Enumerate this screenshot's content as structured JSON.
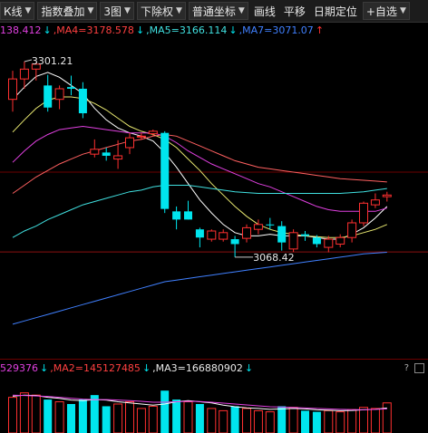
{
  "toolbar": {
    "items": [
      {
        "label": "К线",
        "dropdown": true
      },
      {
        "label": "指数叠加",
        "dropdown": true
      },
      {
        "label": "3图",
        "dropdown": true
      },
      {
        "label": "下除权",
        "dropdown": true
      },
      {
        "label": "普通坐标",
        "dropdown": true
      },
      {
        "label": "画线",
        "dropdown": false
      },
      {
        "label": "平移",
        "dropdown": false
      },
      {
        "label": "日期定位",
        "dropdown": false
      },
      {
        "label": "+自选",
        "dropdown": true
      }
    ]
  },
  "price_info": {
    "ma3": "138.412",
    "ma4": ",MA4=3178.578",
    "ma5": ",MA5=3166.114",
    "ma7": ",MA7=3071.07",
    "colors": {
      "ma3": "#e040e0",
      "ma4": "#ff4040",
      "ma5": "#40e0e0",
      "ma7": "#4080ff"
    }
  },
  "volume_info": {
    "ma1": "529376",
    "ma2": ",MA2=145127485",
    "ma3": ",MA3=166880902",
    "colors": {
      "ma1": "#e040e0",
      "ma2": "#ff4040",
      "ma3": "#e8e8e8"
    }
  },
  "chart_data": {
    "type": "candlestick",
    "ylim": [
      2940,
      3330
    ],
    "high_label": "3301.21",
    "low_label": "3068.42",
    "colors": {
      "up": "#ff3030",
      "down": "#00e5ee",
      "ma_a": "#ffffff",
      "ma_b": "#e8e870",
      "ma_c": "#e040e0",
      "ma_d": "#40e0e0",
      "ma_e": "#4080ff",
      "ma_f": "#ff6060"
    },
    "candles": [
      {
        "o": 3255,
        "h": 3290,
        "l": 3240,
        "c": 3280
      },
      {
        "o": 3280,
        "h": 3301.21,
        "l": 3268,
        "c": 3292
      },
      {
        "o": 3292,
        "h": 3300,
        "l": 3278,
        "c": 3298
      },
      {
        "o": 3272,
        "h": 3285,
        "l": 3240,
        "c": 3245
      },
      {
        "o": 3255,
        "h": 3272,
        "l": 3243,
        "c": 3268
      },
      {
        "o": 3270,
        "h": 3284,
        "l": 3260,
        "c": 3268
      },
      {
        "o": 3268,
        "h": 3276,
        "l": 3232,
        "c": 3238
      },
      {
        "o": 3188,
        "h": 3206,
        "l": 3184,
        "c": 3194
      },
      {
        "o": 3190,
        "h": 3196,
        "l": 3180,
        "c": 3186
      },
      {
        "o": 3182,
        "h": 3205,
        "l": 3170,
        "c": 3186
      },
      {
        "o": 3196,
        "h": 3214,
        "l": 3188,
        "c": 3208
      },
      {
        "o": 3210,
        "h": 3214,
        "l": 3206,
        "c": 3210
      },
      {
        "o": 3213,
        "h": 3218,
        "l": 3210,
        "c": 3216
      },
      {
        "o": 3214,
        "h": 3216,
        "l": 3116,
        "c": 3121
      },
      {
        "o": 3118,
        "h": 3124,
        "l": 3096,
        "c": 3108
      },
      {
        "o": 3118,
        "h": 3131,
        "l": 3108,
        "c": 3108
      },
      {
        "o": 3096,
        "h": 3098,
        "l": 3074,
        "c": 3086
      },
      {
        "o": 3084,
        "h": 3096,
        "l": 3081,
        "c": 3094
      },
      {
        "o": 3084,
        "h": 3096,
        "l": 3081,
        "c": 3092
      },
      {
        "o": 3084,
        "h": 3088,
        "l": 3062,
        "c": 3078
      },
      {
        "o": 3085,
        "h": 3102,
        "l": 3080,
        "c": 3098
      },
      {
        "o": 3096,
        "h": 3108,
        "l": 3090,
        "c": 3102
      },
      {
        "o": 3102,
        "h": 3110,
        "l": 3096,
        "c": 3101
      },
      {
        "o": 3100,
        "h": 3106,
        "l": 3070,
        "c": 3080
      },
      {
        "o": 3072,
        "h": 3096,
        "l": 3068.42,
        "c": 3092
      },
      {
        "o": 3090,
        "h": 3094,
        "l": 3082,
        "c": 3088
      },
      {
        "o": 3086,
        "h": 3089,
        "l": 3074,
        "c": 3078
      },
      {
        "o": 3074,
        "h": 3088,
        "l": 3068,
        "c": 3084
      },
      {
        "o": 3078,
        "h": 3090,
        "l": 3074,
        "c": 3086
      },
      {
        "o": 3086,
        "h": 3108,
        "l": 3080,
        "c": 3104
      },
      {
        "o": 3104,
        "h": 3130,
        "l": 3100,
        "c": 3128
      },
      {
        "o": 3126,
        "h": 3140,
        "l": 3122,
        "c": 3132
      },
      {
        "o": 3136,
        "h": 3142,
        "l": 3130,
        "c": 3138
      }
    ],
    "ma_lines": [
      {
        "key": "ma_a",
        "values": [
          3255,
          3270,
          3283,
          3288,
          3282,
          3272,
          3262,
          3244,
          3230,
          3220,
          3214,
          3210,
          3204,
          3190,
          3172,
          3152,
          3132,
          3116,
          3102,
          3092,
          3088,
          3088,
          3090,
          3088,
          3088,
          3088,
          3086,
          3084,
          3084,
          3090,
          3098,
          3110,
          3124
        ]
      },
      {
        "key": "ma_b",
        "values": [
          3215,
          3230,
          3244,
          3254,
          3258,
          3258,
          3256,
          3250,
          3242,
          3232,
          3222,
          3216,
          3212,
          3206,
          3196,
          3182,
          3168,
          3152,
          3138,
          3124,
          3112,
          3102,
          3096,
          3092,
          3090,
          3088,
          3087,
          3086,
          3086,
          3088,
          3092,
          3096,
          3102
        ]
      },
      {
        "key": "ma_c",
        "values": [
          3178,
          3192,
          3204,
          3212,
          3218,
          3220,
          3222,
          3220,
          3218,
          3216,
          3214,
          3214,
          3214,
          3210,
          3202,
          3192,
          3184,
          3176,
          3170,
          3164,
          3158,
          3152,
          3148,
          3142,
          3136,
          3130,
          3124,
          3120,
          3118,
          3118,
          3118,
          3118,
          3122
        ]
      },
      {
        "key": "ma_f",
        "values": [
          3140,
          3150,
          3160,
          3168,
          3176,
          3182,
          3188,
          3192,
          3196,
          3200,
          3204,
          3206,
          3210,
          3212,
          3210,
          3204,
          3198,
          3192,
          3186,
          3180,
          3176,
          3172,
          3170,
          3168,
          3166,
          3164,
          3162,
          3160,
          3158,
          3157,
          3156,
          3155,
          3154
        ]
      },
      {
        "key": "ma_d",
        "values": [
          3086,
          3094,
          3100,
          3108,
          3114,
          3120,
          3126,
          3130,
          3134,
          3138,
          3142,
          3144,
          3148,
          3150,
          3150,
          3150,
          3148,
          3146,
          3144,
          3142,
          3141,
          3140,
          3140,
          3140,
          3140,
          3140,
          3140,
          3140,
          3140,
          3141,
          3142,
          3144,
          3146
        ]
      },
      {
        "key": "ma_e",
        "values": [
          2980,
          2984,
          2988,
          2992,
          2996,
          3000,
          3004,
          3008,
          3012,
          3016,
          3020,
          3024,
          3028,
          3032,
          3034,
          3036,
          3038,
          3040,
          3042,
          3044,
          3046,
          3048,
          3050,
          3052,
          3054,
          3056,
          3058,
          3060,
          3062,
          3064,
          3066,
          3067,
          3068
        ]
      }
    ],
    "volume": {
      "ylim": [
        0,
        260000000
      ],
      "bars": [
        {
          "v": 160000000,
          "up": true
        },
        {
          "v": 180000000,
          "up": true
        },
        {
          "v": 170000000,
          "up": true
        },
        {
          "v": 150000000,
          "up": false
        },
        {
          "v": 140000000,
          "up": true
        },
        {
          "v": 130000000,
          "up": false
        },
        {
          "v": 150000000,
          "up": false
        },
        {
          "v": 170000000,
          "up": false
        },
        {
          "v": 120000000,
          "up": false
        },
        {
          "v": 130000000,
          "up": true
        },
        {
          "v": 140000000,
          "up": true
        },
        {
          "v": 110000000,
          "up": true
        },
        {
          "v": 120000000,
          "up": true
        },
        {
          "v": 190000000,
          "up": false
        },
        {
          "v": 150000000,
          "up": false
        },
        {
          "v": 140000000,
          "up": true
        },
        {
          "v": 130000000,
          "up": false
        },
        {
          "v": 110000000,
          "up": true
        },
        {
          "v": 100000000,
          "up": true
        },
        {
          "v": 120000000,
          "up": false
        },
        {
          "v": 110000000,
          "up": true
        },
        {
          "v": 100000000,
          "up": true
        },
        {
          "v": 95000000,
          "up": true
        },
        {
          "v": 120000000,
          "up": false
        },
        {
          "v": 115000000,
          "up": true
        },
        {
          "v": 100000000,
          "up": false
        },
        {
          "v": 95000000,
          "up": false
        },
        {
          "v": 100000000,
          "up": true
        },
        {
          "v": 95000000,
          "up": true
        },
        {
          "v": 105000000,
          "up": true
        },
        {
          "v": 115000000,
          "up": true
        },
        {
          "v": 110000000,
          "up": true
        },
        {
          "v": 135000000,
          "up": true
        }
      ],
      "ma_lines": [
        {
          "key": "vma_a",
          "color": "#ffffff",
          "values": [
            165000000,
            170000000,
            168000000,
            160000000,
            155000000,
            148000000,
            145000000,
            150000000,
            148000000,
            140000000,
            135000000,
            130000000,
            125000000,
            130000000,
            140000000,
            145000000,
            140000000,
            135000000,
            125000000,
            118000000,
            113000000,
            110000000,
            106000000,
            108000000,
            110000000,
            108000000,
            104000000,
            102000000,
            100000000,
            101000000,
            104000000,
            106000000,
            112000000
          ]
        },
        {
          "key": "vma_b",
          "color": "#e040e0",
          "values": [
            170000000,
            168000000,
            166000000,
            164000000,
            160000000,
            156000000,
            152000000,
            150000000,
            150000000,
            148000000,
            145000000,
            142000000,
            138000000,
            138000000,
            140000000,
            142000000,
            141000000,
            138000000,
            134000000,
            130000000,
            126000000,
            122000000,
            118000000,
            116000000,
            114000000,
            112000000,
            110000000,
            108000000,
            106000000,
            105000000,
            105000000,
            106000000,
            108000000
          ]
        }
      ]
    }
  }
}
